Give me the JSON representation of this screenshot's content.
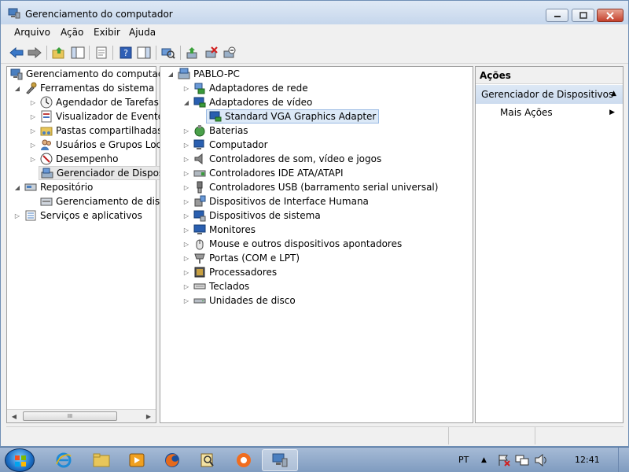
{
  "window": {
    "title": "Gerenciamento do computador"
  },
  "menu": [
    "Arquivo",
    "Ação",
    "Exibir",
    "Ajuda"
  ],
  "left_tree": [
    {
      "label": "Gerenciamento do computado",
      "icon": "computer-management-icon",
      "arrow": ""
    },
    {
      "label": "Ferramentas do sistema",
      "icon": "tools-icon",
      "arrow": "expanded"
    },
    {
      "label": "Agendador de Tarefas",
      "icon": "clock-icon",
      "arrow": "collapsed"
    },
    {
      "label": "Visualizador de Eventos",
      "icon": "event-viewer-icon",
      "arrow": "collapsed"
    },
    {
      "label": "Pastas compartilhadas",
      "icon": "shared-folders-icon",
      "arrow": "collapsed"
    },
    {
      "label": "Usuários e Grupos Loca",
      "icon": "users-icon",
      "arrow": "collapsed"
    },
    {
      "label": "Desempenho",
      "icon": "performance-icon",
      "arrow": "collapsed"
    },
    {
      "label": "Gerenciador de Disposit",
      "icon": "device-manager-icon",
      "arrow": "",
      "selected": true
    },
    {
      "label": "Repositório",
      "icon": "storage-icon",
      "arrow": "expanded"
    },
    {
      "label": "Gerenciamento de disco",
      "icon": "disk-management-icon",
      "arrow": ""
    },
    {
      "label": "Serviços e aplicativos",
      "icon": "services-icon",
      "arrow": "collapsed"
    }
  ],
  "scroll_label": "III",
  "device_tree": {
    "root": "PABLO-PC",
    "categories": [
      {
        "label": "Adaptadores de rede",
        "arrow": "collapsed",
        "icon": "network-adapter-icon"
      },
      {
        "label": "Adaptadores de vídeo",
        "arrow": "expanded",
        "icon": "display-adapter-icon"
      },
      {
        "label": "Standard VGA Graphics Adapter",
        "arrow": "",
        "icon": "display-adapter-icon",
        "child": true,
        "selected": true
      },
      {
        "label": "Baterias",
        "arrow": "collapsed",
        "icon": "battery-icon"
      },
      {
        "label": "Computador",
        "arrow": "collapsed",
        "icon": "computer-icon"
      },
      {
        "label": "Controladores de som, vídeo e jogos",
        "arrow": "collapsed",
        "icon": "speaker-icon"
      },
      {
        "label": "Controladores IDE ATA/ATAPI",
        "arrow": "collapsed",
        "icon": "ide-controller-icon"
      },
      {
        "label": "Controladores USB (barramento serial universal)",
        "arrow": "collapsed",
        "icon": "usb-icon"
      },
      {
        "label": "Dispositivos de Interface Humana",
        "arrow": "collapsed",
        "icon": "hid-icon"
      },
      {
        "label": "Dispositivos de sistema",
        "arrow": "collapsed",
        "icon": "system-devices-icon"
      },
      {
        "label": "Monitores",
        "arrow": "collapsed",
        "icon": "monitor-icon"
      },
      {
        "label": "Mouse e outros dispositivos apontadores",
        "arrow": "collapsed",
        "icon": "mouse-icon"
      },
      {
        "label": "Portas (COM e LPT)",
        "arrow": "collapsed",
        "icon": "port-icon"
      },
      {
        "label": "Processadores",
        "arrow": "collapsed",
        "icon": "processor-icon"
      },
      {
        "label": "Teclados",
        "arrow": "collapsed",
        "icon": "keyboard-icon"
      },
      {
        "label": "Unidades de disco",
        "arrow": "collapsed",
        "icon": "disk-drive-icon"
      }
    ]
  },
  "actions": {
    "header": "Ações",
    "group": "Gerenciador de Dispositivos",
    "more": "Mais Ações"
  },
  "taskbar": {
    "language": "PT",
    "clock": "12:41"
  }
}
